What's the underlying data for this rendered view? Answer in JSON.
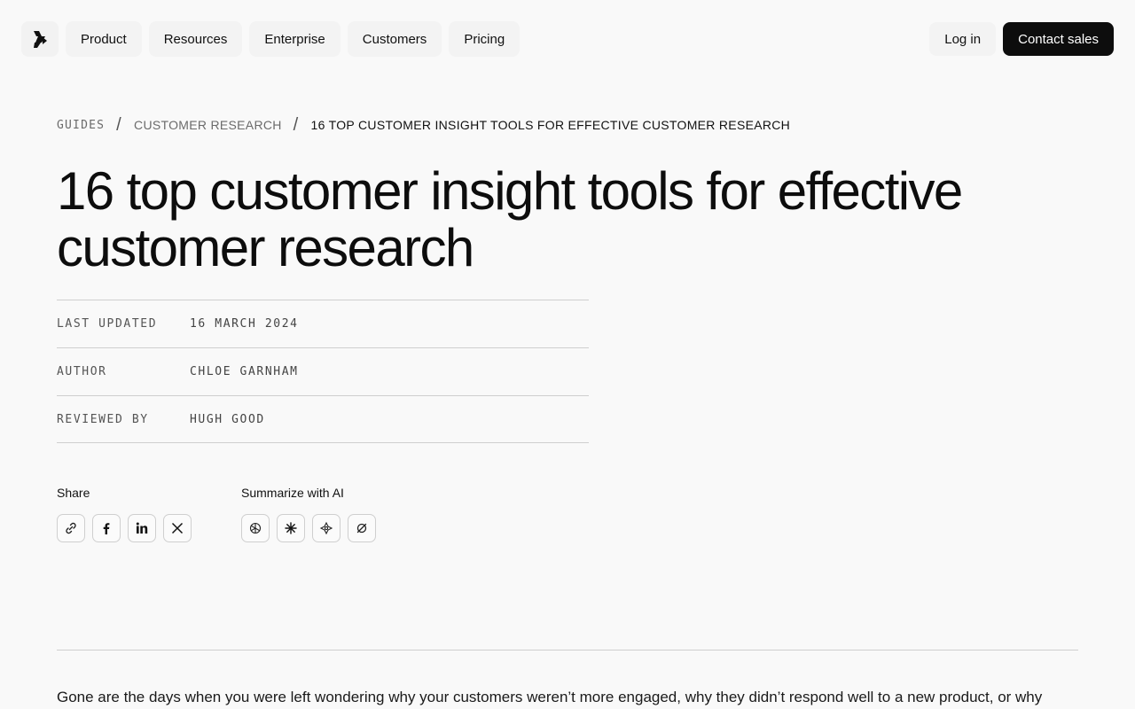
{
  "nav": {
    "logo_icon": "dovetail-logo-icon",
    "items": [
      {
        "label": "Product"
      },
      {
        "label": "Resources"
      },
      {
        "label": "Enterprise"
      },
      {
        "label": "Customers"
      },
      {
        "label": "Pricing"
      }
    ],
    "login_label": "Log in",
    "contact_label": "Contact sales"
  },
  "breadcrumb": {
    "items": [
      {
        "label": "GUIDES"
      },
      {
        "label": "CUSTOMER RESEARCH"
      },
      {
        "label": "16 TOP CUSTOMER INSIGHT TOOLS FOR EFFECTIVE CUSTOMER RESEARCH"
      }
    ],
    "separator": "/"
  },
  "article": {
    "title": "16 top customer insight tools for effective customer research",
    "meta": [
      {
        "label": "LAST UPDATED",
        "value": "16 MARCH 2024"
      },
      {
        "label": "AUTHOR",
        "value": "CHLOE GARNHAM"
      },
      {
        "label": "REVIEWED BY",
        "value": "HUGH GOOD"
      }
    ],
    "share": {
      "title": "Share",
      "icons": [
        "link-icon",
        "facebook-icon",
        "linkedin-icon",
        "x-icon"
      ]
    },
    "summarize": {
      "title": "Summarize with AI",
      "icons": [
        "chatgpt-icon",
        "claude-icon",
        "gemini-icon",
        "perplexity-icon"
      ]
    },
    "intro": "Gone are the days when you were left wondering why your customers weren’t more engaged, why they didn’t respond well to a new product, or why"
  },
  "colors": {
    "background": "#f9f9f9",
    "primary_button": "#0d0d0d",
    "text": "#111111",
    "muted": "#6b6b6b",
    "border": "#cfcfcf"
  }
}
